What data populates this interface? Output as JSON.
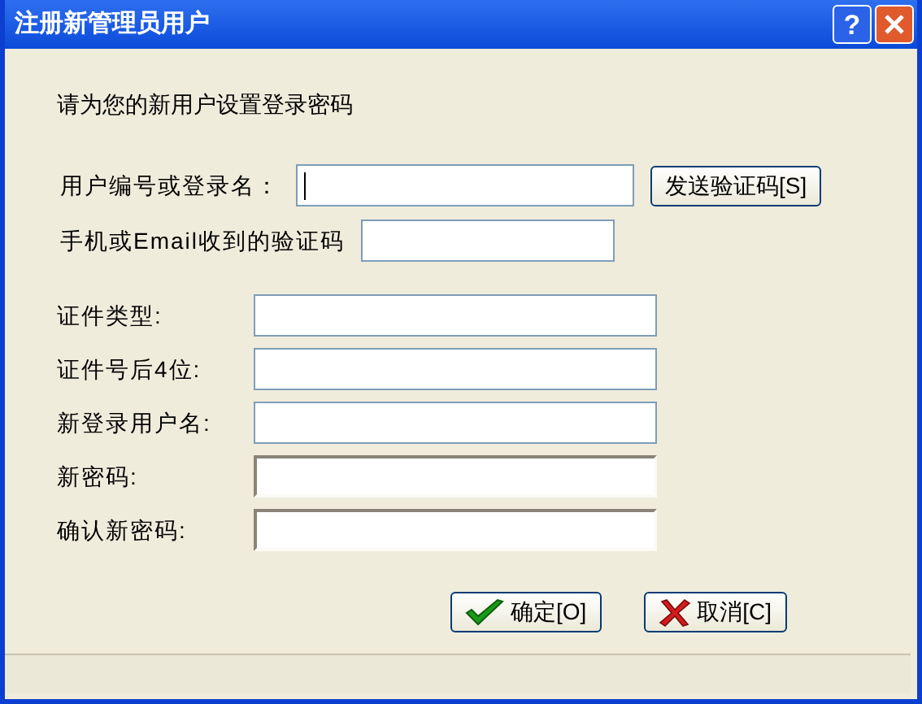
{
  "window": {
    "title": "注册新管理员用户",
    "buttons": [
      {
        "kind": "help",
        "label": "?"
      },
      {
        "kind": "close"
      }
    ]
  },
  "heading": "请为您的新用户设置登录密码",
  "verify_fields": [
    {
      "label": "用户编号或登录名：",
      "kind": "text",
      "focused": true,
      "button": "发送验证码[S]"
    },
    {
      "label": "手机或Email收到的验证码",
      "kind": "text",
      "focused": false
    }
  ],
  "fields": [
    {
      "label": "证件类型:",
      "kind": "text",
      "focused": false
    },
    {
      "label": "证件号后4位:",
      "kind": "text",
      "focused": false
    },
    {
      "label": "新登录用户名:",
      "kind": "text",
      "focused": false
    },
    {
      "label": "新密码:",
      "kind": "password",
      "focused": false
    },
    {
      "label": "确认新密码:",
      "kind": "password",
      "focused": false
    }
  ],
  "actions": [
    {
      "kind": "ok",
      "label": "确定[O]"
    },
    {
      "kind": "cancel",
      "label": "取消[C]"
    }
  ]
}
